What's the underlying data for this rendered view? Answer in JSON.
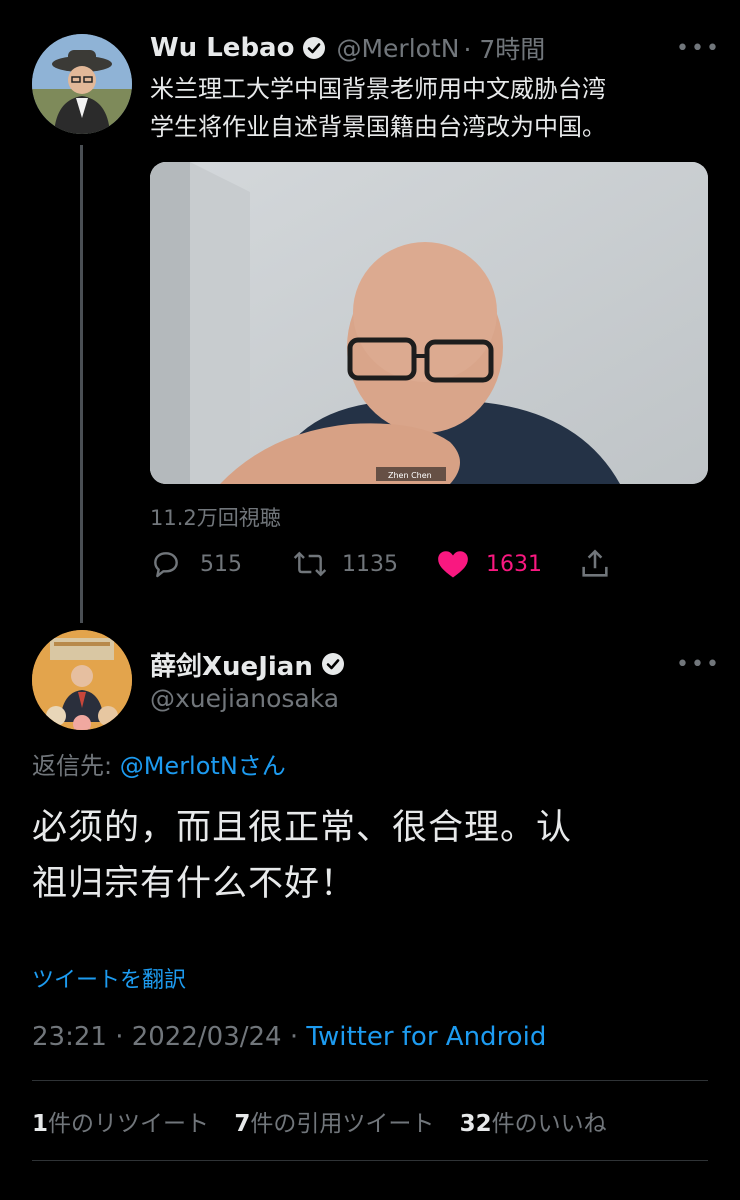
{
  "tweet1": {
    "name": "Wu Lebao",
    "handle": "@MerlotN",
    "time": "· 7時間",
    "more": "•••",
    "text_line1": "米兰理工大学中国背景老师用中文威胁台湾",
    "text_line2": "学生将作业自述背景国籍由台湾改为中国。",
    "video_caption": "Zhen Chen",
    "views": "11.2万回視聴",
    "replies": "515",
    "retweets": "1135",
    "likes": "1631",
    "colors": {
      "like": "#f91880",
      "muted": "#71767b"
    },
    "icons": [
      "reply-icon",
      "retweet-icon",
      "heart-icon",
      "share-icon"
    ]
  },
  "tweet2": {
    "name": "薛剑XueJian",
    "handle": "@xuejianosaka",
    "more": "•••",
    "reply_prefix": "返信先: ",
    "reply_to": "@MerlotNさん",
    "text_line1": "必须的，而且很正常、很合理。认",
    "text_line2": "祖归宗有什么不好！",
    "translate": "ツイートを翻訳",
    "datetime": "23:21 · 2022/03/24 · ",
    "source": "Twitter for Android",
    "retweet_count": "1",
    "retweet_label": "件のリツイート",
    "quote_count": "7",
    "quote_label": "件の引用ツイート",
    "like_count": "32",
    "like_label": "件のいいね",
    "colors": {
      "link": "#1d9bf0"
    }
  }
}
